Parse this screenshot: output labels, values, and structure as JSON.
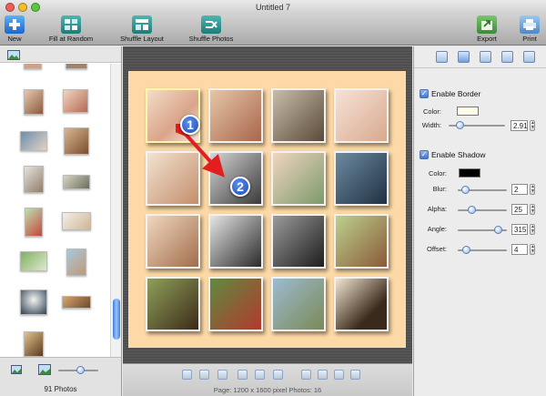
{
  "window": {
    "title": "Untitled 7"
  },
  "toolbar": {
    "new": "New",
    "fill_random": "Fill at Random",
    "shuffle_layout": "Shuffle Layout",
    "shuffle_photos": "Shuffle Photos",
    "export": "Export",
    "print": "Print"
  },
  "library": {
    "photo_count": "91 Photos"
  },
  "canvas": {
    "badges": [
      "1",
      "2"
    ],
    "status": "Page: 1200 x 1600 pixel  Photos: 16"
  },
  "settings": {
    "border": {
      "enable_label": "Enable Border",
      "color_label": "Color:",
      "color": "#fffce8",
      "width_label": "Width:",
      "width_value": "2.91",
      "width_slider": 0.15
    },
    "shadow": {
      "enable_label": "Enable Shadow",
      "color_label": "Color:",
      "color": "#000000",
      "blur_label": "Blur:",
      "blur_value": "2",
      "blur_slider": 0.08,
      "alpha_label": "Alpha:",
      "alpha_value": "25",
      "alpha_slider": 0.25,
      "angle_label": "Angle:",
      "angle_value": "315",
      "angle_slider": 0.88,
      "offset_label": "Offset:",
      "offset_value": "4",
      "offset_slider": 0.12
    }
  },
  "colors": {
    "accent": "#2f6fe0",
    "page_bg": "#fcd9a6",
    "arrow": "#e21e1e"
  }
}
